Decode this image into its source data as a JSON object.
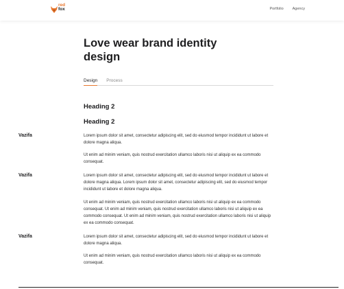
{
  "header": {
    "logo_word1": "red",
    "logo_word2": "fox",
    "nav": [
      "Portfolio",
      "Agency"
    ]
  },
  "page": {
    "title": "Love wear brand identity design",
    "tabs": [
      "Design",
      "Process"
    ],
    "headings": [
      "Heading 2",
      "Heading 2"
    ]
  },
  "rows": [
    {
      "label": "Vazifa",
      "paragraphs": [
        "Lorem ipsum dolor sit amet, consectetur adipiscing elit, sed do eiusmod tempor incididunt ut labore et dolore magna aliqua.",
        "Ut enim ad minim veniam, quis nostrud exercitation ullamco laboris nisi ut aliquip ex ea commodo consequat."
      ]
    },
    {
      "label": "Vazifa",
      "paragraphs": [
        "Lorem ipsum dolor sit amet, consectetur adipiscing elit, sed do eiusmod tempor incididunt ut labore et dolore magna aliqua. Lorem ipsum dolor sit amet, consectetur adipiscing elit, sed do eiusmod tempor incididunt ut labore et dolore magna aliqua.",
        "Ut enim ad minim veniam, quis nostrud exercitation ullamco laboris nisi ut aliquip ex ea commodo consequat. Ut enim ad minim veniam, quis nostrud exercitation ullamco laboris nisi ut aliquip ex ea commodo consequat. Ut enim ad minim veniam, quis nostrud exercitation ullamco laboris nisi ut aliquip ex ea commodo consequat."
      ]
    },
    {
      "label": "Vazifa",
      "paragraphs": [
        "Lorem ipsum dolor sit amet, consectetur adipiscing elit, sed do eiusmod tempor incididunt ut labore et dolore magna aliqua.",
        "Ut enim ad minim veniam, quis nostrud exercitation ullamco laboris nisi ut aliquip ex ea commodo consequat."
      ]
    }
  ],
  "colors": {
    "accent": "#e8772e",
    "text": "#1d1d1f"
  }
}
